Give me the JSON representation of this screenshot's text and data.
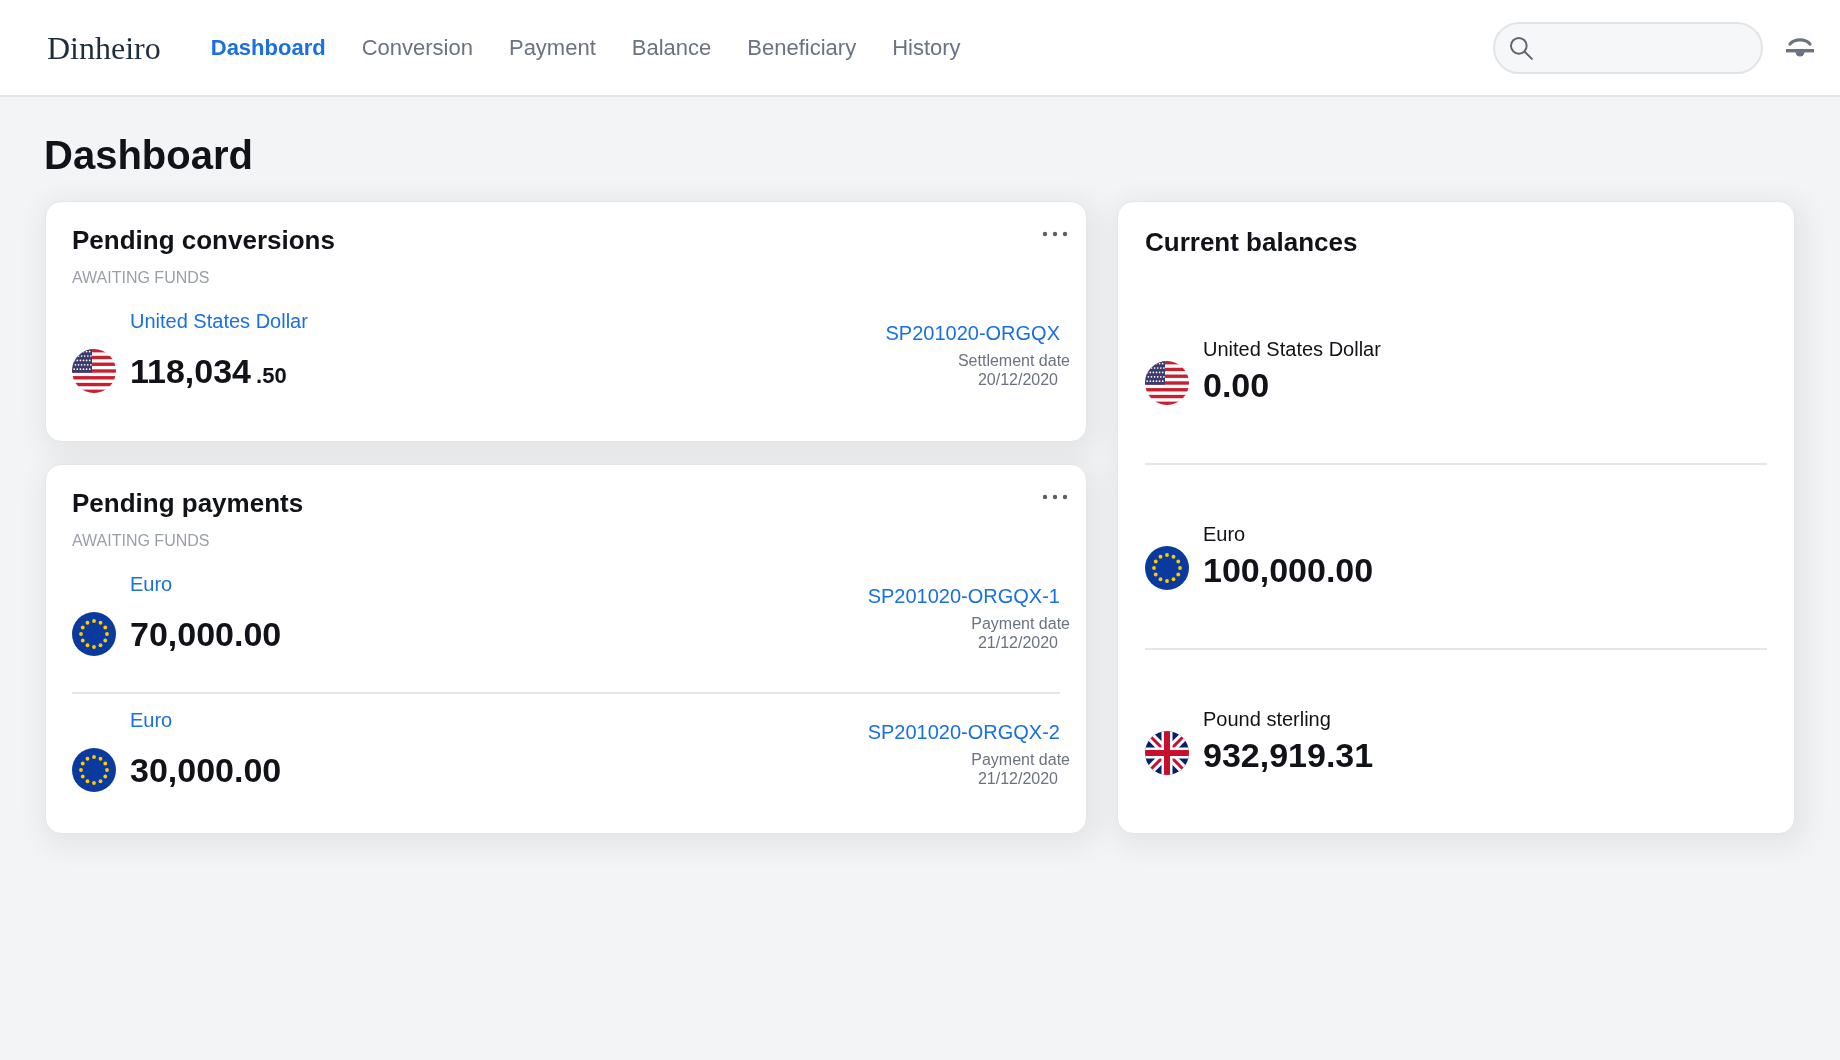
{
  "header": {
    "logo": "Dinheiro",
    "nav": [
      {
        "label": "Dashboard",
        "selected": true
      },
      {
        "label": "Conversion",
        "selected": false
      },
      {
        "label": "Payment",
        "selected": false
      },
      {
        "label": "Balance",
        "selected": false
      },
      {
        "label": "Beneficiary",
        "selected": false
      },
      {
        "label": "History",
        "selected": false
      }
    ]
  },
  "page_title": "Dashboard",
  "pending_conversions": {
    "title": "Pending conversions",
    "status": "AWAITING FUNDS",
    "items": [
      {
        "kind": "usd",
        "currency": "United States Dollar",
        "amount": "118,034",
        "amount_fraction": ".50",
        "reference": "SP201020-ORGQX",
        "date_label": "Settlement date",
        "date": "20/12/2020"
      }
    ]
  },
  "pending_payments": {
    "title": "Pending payments",
    "status": "AWAITING FUNDS",
    "items": [
      {
        "kind": "eur",
        "currency": "Euro",
        "amount": "70,000.00",
        "reference": "SP201020-ORGQX-1",
        "date_label": "Payment date",
        "date": "21/12/2020"
      },
      {
        "kind": "eur",
        "currency": "Euro",
        "amount": "30,000.00",
        "reference": "SP201020-ORGQX-2",
        "date_label": "Payment date",
        "date": "21/12/2020"
      }
    ]
  },
  "current_balances": {
    "title": "Current balances",
    "items": [
      {
        "kind": "usd",
        "currency": "United States Dollar",
        "amount": "0.00"
      },
      {
        "kind": "eur",
        "currency": "Euro",
        "amount": "100,000.00"
      },
      {
        "kind": "gbp",
        "currency": "Pound sterling",
        "amount": "932,919.31"
      }
    ]
  }
}
